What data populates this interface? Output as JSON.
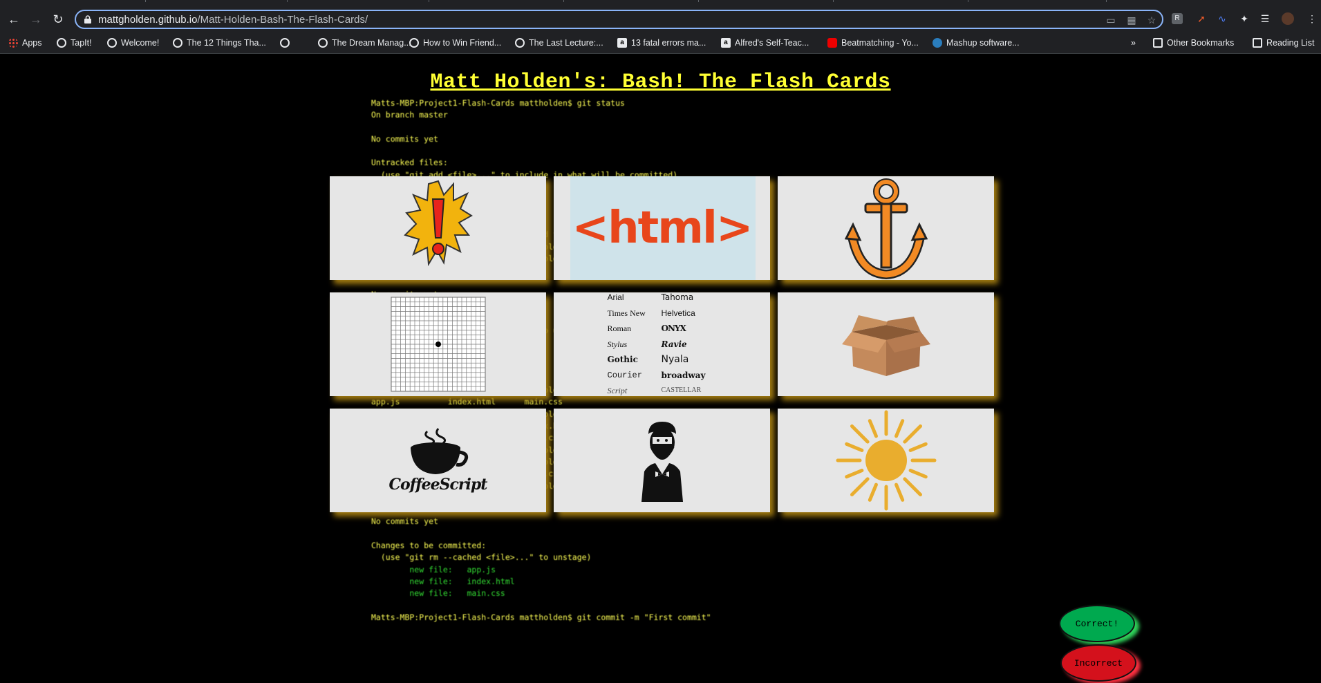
{
  "browser": {
    "url_host": "mattgholden.github.io",
    "url_path": "/Matt-Holden-Bash-The-Flash-Cards/",
    "bookmarks": [
      {
        "label": "Apps",
        "icon": "apps-grid-icon"
      },
      {
        "label": "TapIt!",
        "icon": "globe-icon"
      },
      {
        "label": "Welcome!",
        "icon": "globe-icon"
      },
      {
        "label": "The 12 Things Tha...",
        "icon": "globe-icon"
      },
      {
        "label": "",
        "icon": "globe-icon"
      },
      {
        "label": "The Dream Manag...",
        "icon": "globe-icon"
      },
      {
        "label": "How to Win Friend...",
        "icon": "globe-icon"
      },
      {
        "label": "The Last Lecture:...",
        "icon": "globe-icon"
      },
      {
        "label": "13 fatal errors ma...",
        "icon": "amazon-icon"
      },
      {
        "label": "Alfred's Self-Teac...",
        "icon": "amazon-icon"
      },
      {
        "label": "Beatmatching - Yo...",
        "icon": "youtube-icon"
      },
      {
        "label": "Mashup software...",
        "icon": "mashup-icon"
      }
    ],
    "overflow_label": "»",
    "other_bookmarks": "Other Bookmarks",
    "reading_list": "Reading List"
  },
  "page": {
    "title": "Matt Holden's: Bash! The Flash Cards",
    "terminal": [
      {
        "text": "Matts-MBP:Project1-Flash-Cards mattholden$ git status",
        "green": false
      },
      {
        "text": "On branch master",
        "green": false
      },
      {
        "text": "",
        "green": false
      },
      {
        "text": "No commits yet",
        "green": false
      },
      {
        "text": "",
        "green": false
      },
      {
        "text": "Untracked files:",
        "green": false
      },
      {
        "text": "  (use \"git add <file>...\" to include in what will be committed)",
        "green": false
      },
      {
        "text": "",
        "green": false
      },
      {
        "text": "",
        "green": false
      },
      {
        "text": "",
        "green": false
      },
      {
        "text": "",
        "green": false
      },
      {
        "text": "nothing added to commit but untracked files present (use \"git add\" to track)",
        "green": false
      },
      {
        "text": "Matts-MBP:Project1-Flash-Cards mattholden$ git add .",
        "green": false
      },
      {
        "text": "Matts-MBP:Project1-Flash-Cards mattholden$ git status",
        "green": false
      },
      {
        "text": "On branch master",
        "green": false
      },
      {
        "text": "",
        "green": false
      },
      {
        "text": "No commits yet",
        "green": false
      },
      {
        "text": "",
        "green": false
      },
      {
        "text": "Changes to be committed:",
        "green": false
      },
      {
        "text": "  (use \"git rm --cached <file>...\" to unstage)",
        "green": false
      },
      {
        "text": "        new file:   app.js",
        "green": true
      },
      {
        "text": "        new file:   index.html",
        "green": true
      },
      {
        "text": "        new file:   main.css",
        "green": true
      },
      {
        "text": "",
        "green": false
      },
      {
        "text": "Matts-MBP:Project1-Flash-Cards mattholden$ ls",
        "green": false
      },
      {
        "text": "app.js          index.html      main.css",
        "green": false
      },
      {
        "text": "Matts-MBP:Project1-Flash-Cards mattholden$ ls -a",
        "green": false
      },
      {
        "text": ".               .git            index.html",
        "green": false
      },
      {
        "text": "..              app.js          main.css",
        "green": false
      },
      {
        "text": "Matts-MBP:Project1-Flash-Cards mattholden$ git remote -v",
        "green": false
      },
      {
        "text": "Matts-MBP:Project1-Flash-Cards mattholden$ ls",
        "green": false
      },
      {
        "text": "app.js          index.html      main.css",
        "green": false
      },
      {
        "text": "Matts-MBP:Project1-Flash-Cards mattholden$ git status",
        "green": false
      },
      {
        "text": "On branch master",
        "green": false
      },
      {
        "text": "",
        "green": false
      },
      {
        "text": "No commits yet",
        "green": false
      },
      {
        "text": "",
        "green": false
      },
      {
        "text": "Changes to be committed:",
        "green": false
      },
      {
        "text": "  (use \"git rm --cached <file>...\" to unstage)",
        "green": false
      },
      {
        "text": "        new file:   app.js",
        "green": true
      },
      {
        "text": "        new file:   index.html",
        "green": true
      },
      {
        "text": "        new file:   main.css",
        "green": true
      },
      {
        "text": "",
        "green": false
      },
      {
        "text": "Matts-MBP:Project1-Flash-Cards mattholden$ git commit -m \"First commit\"",
        "green": false
      }
    ],
    "cards": [
      {
        "image": "exclamation-burst-icon"
      },
      {
        "image": "html-tag-icon",
        "text": "<html>"
      },
      {
        "image": "anchor-icon"
      },
      {
        "image": "grid-dot-icon"
      },
      {
        "image": "font-samples-icon",
        "fonts": [
          "Arial",
          "Tahoma",
          "Times New",
          "Helvetica",
          "Roman",
          "ONYX",
          "Stylus",
          "Ravie",
          "Gothic",
          "Nyala",
          "Courier",
          "broadway",
          "Script",
          "CASTELLAR"
        ]
      },
      {
        "image": "cardboard-box-icon"
      },
      {
        "image": "coffeescript-logo-icon",
        "text": "CoffeeScript"
      },
      {
        "image": "bearded-man-icon"
      },
      {
        "image": "sun-icon"
      }
    ],
    "correct_label": "Correct!",
    "incorrect_label": "Incorrect"
  },
  "colors": {
    "title": "#ffff33",
    "terminal_text": "#ffff55",
    "terminal_green": "#33dd33",
    "card_bg": "#e6e6e6",
    "card_shadow": "#a07a10",
    "correct": "#00a94f",
    "incorrect": "#d4111c"
  }
}
